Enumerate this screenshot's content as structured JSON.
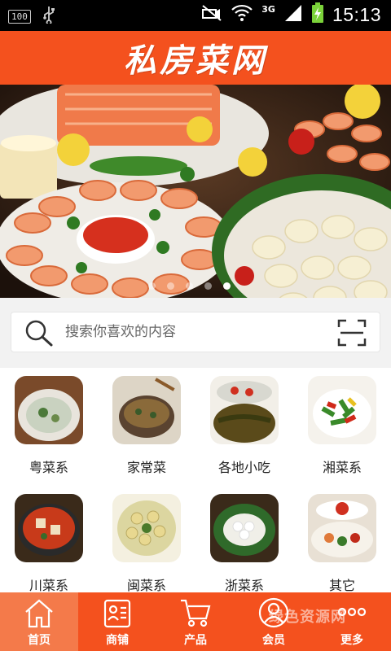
{
  "status_bar": {
    "battery": "100",
    "network": "3G",
    "time": "15:13"
  },
  "header": {
    "title": "私房菜网"
  },
  "banner": {
    "slide_count": 5,
    "active_slide": 5
  },
  "search": {
    "placeholder": "搜索你喜欢的内容"
  },
  "categories": [
    {
      "label": "粤菜系"
    },
    {
      "label": "家常菜"
    },
    {
      "label": "各地小吃"
    },
    {
      "label": "湘菜系"
    },
    {
      "label": "川菜系"
    },
    {
      "label": "闽菜系"
    },
    {
      "label": "浙菜系"
    },
    {
      "label": "其它"
    }
  ],
  "tabs": [
    {
      "label": "首页",
      "icon": "home-icon",
      "active": true
    },
    {
      "label": "商铺",
      "icon": "shop-icon",
      "active": false
    },
    {
      "label": "产品",
      "icon": "cart-icon",
      "active": false
    },
    {
      "label": "会员",
      "icon": "user-icon",
      "active": false
    },
    {
      "label": "更多",
      "icon": "more-icon",
      "active": false
    }
  ],
  "watermark": "绿色资源网",
  "colors": {
    "brand": "#f4511e",
    "active_tab": "#f47a4a",
    "search_bg": "#f2f2f2"
  }
}
